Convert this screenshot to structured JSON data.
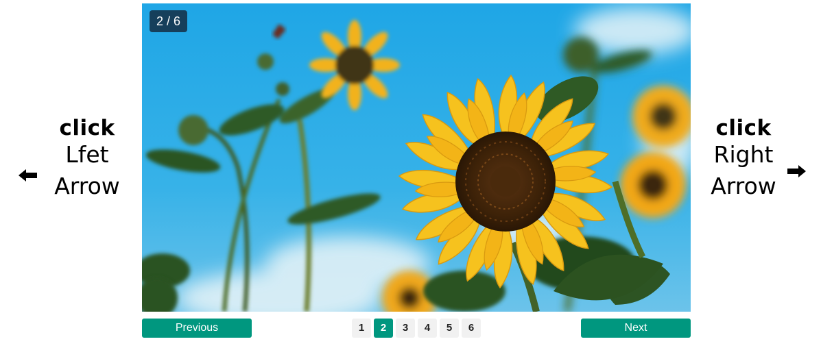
{
  "left_hint": {
    "click_label": "click",
    "line1": "Lfet",
    "line2": "Arrow",
    "arrow_icon": "left-arrow-icon"
  },
  "right_hint": {
    "click_label": "click",
    "line1": "Right",
    "line2": "Arrow",
    "arrow_icon": "right-arrow-icon"
  },
  "slider": {
    "counter": "2 / 6",
    "current_page": 2,
    "image_subject": "sunflower"
  },
  "controls": {
    "previous_label": "Previous",
    "next_label": "Next",
    "pages": [
      "1",
      "2",
      "3",
      "4",
      "5",
      "6"
    ]
  },
  "colors": {
    "accent": "#00977f",
    "counter_bg": "#14283c"
  }
}
